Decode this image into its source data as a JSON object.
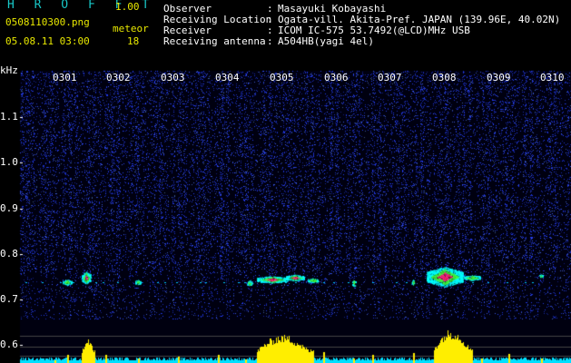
{
  "header": {
    "app_title": "H R O F F T",
    "version": "1.00",
    "filename": "0508110300.png",
    "datetime": "05.08.11 03:00",
    "meteor_label": "meteor",
    "meteor_count": "18"
  },
  "info": [
    {
      "label": "Observer",
      "value": "Masayuki Kobayashi"
    },
    {
      "label": "Receiving Location",
      "value": "Ogata-vill. Akita-Pref. JAPAN (139.96E, 40.02N)"
    },
    {
      "label": "Receiver",
      "value": "ICOM IC-575 53.7492(@LCD)MHz USB"
    },
    {
      "label": "Receiving antenna",
      "value": "A504HB(yagi 4el)"
    }
  ],
  "colon": ":",
  "spectrogram": {
    "y_unit": "kHz",
    "y_ticks": [
      "1.1",
      "1.0",
      "0.9",
      "0.8",
      "0.7",
      "0.6"
    ],
    "time_ticks": [
      "0301",
      "0302",
      "0303",
      "0304",
      "0305",
      "0306",
      "0307",
      "0308",
      "0309",
      "0310"
    ],
    "events": [
      {
        "time": "0301",
        "intensity": "weak"
      },
      {
        "time": "0302",
        "intensity": "strong"
      },
      {
        "time": "0305",
        "intensity": "strong"
      },
      {
        "time": "0306",
        "intensity": "weak"
      },
      {
        "time": "0308",
        "intensity": "very strong"
      }
    ],
    "colors": {
      "background": "#000010",
      "noise": "#2233cc",
      "signal_cyan": "#00ffff",
      "signal_green": "#40ff40",
      "signal_red": "#ff2040",
      "signal_magenta": "#ff30c0",
      "level_bar": "#ffee00",
      "baseline": "#00e0ff"
    }
  }
}
